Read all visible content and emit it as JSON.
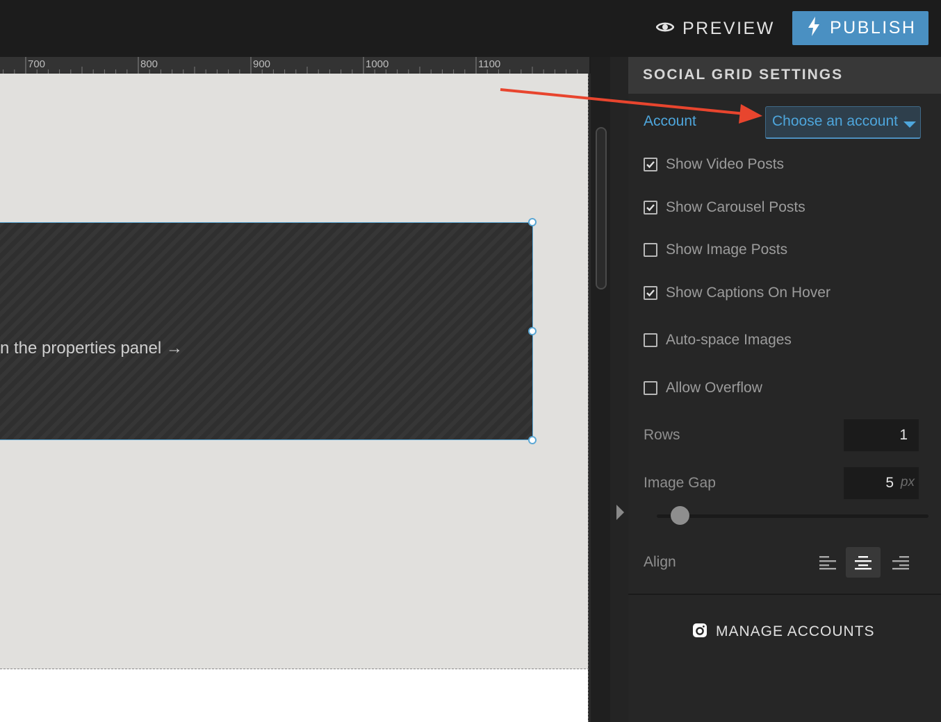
{
  "topbar": {
    "preview_label": "PREVIEW",
    "publish_label": "PUBLISH"
  },
  "ruler": {
    "ticks": [
      "700",
      "800",
      "900",
      "1000",
      "1100"
    ]
  },
  "canvas": {
    "widget_hint": "n the properties panel →"
  },
  "panel": {
    "title": "SOCIAL GRID SETTINGS",
    "account": {
      "label": "Account",
      "value": "Choose an account"
    },
    "checkboxes": [
      {
        "label": "Show Video Posts",
        "checked": true
      },
      {
        "label": "Show Carousel Posts",
        "checked": true
      },
      {
        "label": "Show Image Posts",
        "checked": false
      },
      {
        "label": "Show Captions On Hover",
        "checked": true
      },
      {
        "label": "Auto-space Images",
        "checked": false
      },
      {
        "label": "Allow Overflow",
        "checked": false
      }
    ],
    "rows": {
      "label": "Rows",
      "value": "1"
    },
    "image_gap": {
      "label": "Image Gap",
      "value": "5",
      "unit": "px",
      "slider_fraction": 0.1
    },
    "align": {
      "label": "Align",
      "selected": "center",
      "options": [
        "left",
        "center",
        "right"
      ]
    },
    "manage_label": "MANAGE ACCOUNTS"
  },
  "colors": {
    "accent": "#4a90c2",
    "link": "#4ea6dc",
    "annotation_arrow": "#e8452e"
  }
}
